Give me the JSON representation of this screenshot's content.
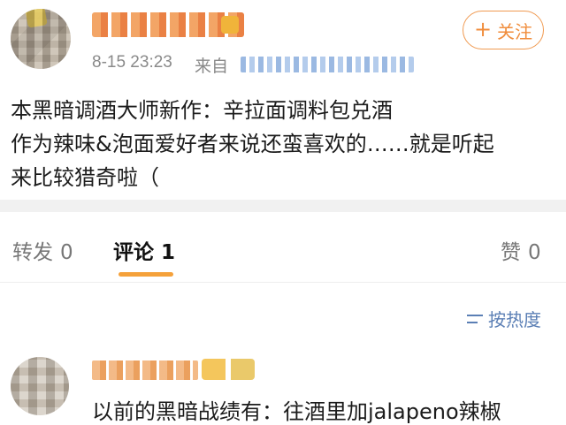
{
  "post": {
    "time": "8-15 23:23",
    "from_label": "来自",
    "follow_label": "关注",
    "follow_icon": "+",
    "body_lines": [
      "本黑暗调酒大师新作：辛拉面调料包兑酒",
      "作为辣味&泡面爱好者来说还蛮喜欢的……就是听起",
      "来比较猎奇啦（"
    ]
  },
  "tabs": {
    "repost_label": "转发",
    "repost_count": "0",
    "comment_label": "评论",
    "comment_count": "1",
    "like_label": "赞",
    "like_count": "0"
  },
  "sort": {
    "label": "按热度",
    "icon": "sort-icon"
  },
  "comment": {
    "text": "以前的黑暗战绩有：往酒里加jalapeno辣椒"
  },
  "colors": {
    "accent": "#f5a13a",
    "link_blue": "#5b7fb5",
    "meta_gray": "#8a8a8a"
  }
}
